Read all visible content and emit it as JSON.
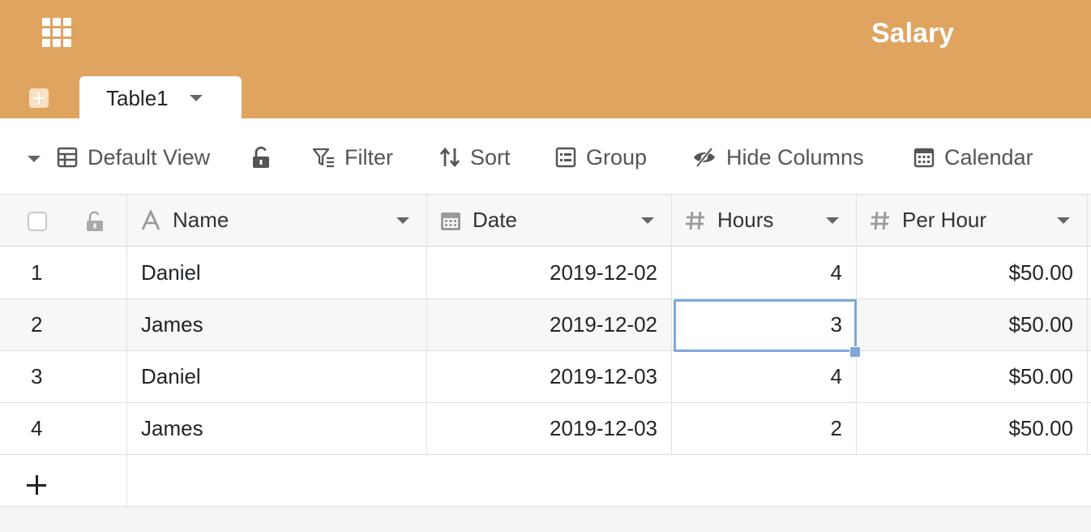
{
  "header": {
    "base_title": "Salary",
    "background_color": "#dea460",
    "apps_icon": "apps-grid-icon",
    "add_table_icon": "add-icon",
    "active_table": "Table1"
  },
  "toolbar": {
    "view_name": "Default View",
    "lock_icon": "lock-open-icon",
    "filter_label": "Filter",
    "sort_label": "Sort",
    "group_label": "Group",
    "hide_columns_label": "Hide Columns",
    "calendar_label": "Calendar"
  },
  "table": {
    "columns": [
      {
        "label": "Name",
        "type": "text",
        "icon": "text-type-icon"
      },
      {
        "label": "Date",
        "type": "date",
        "icon": "calendar-icon"
      },
      {
        "label": "Hours",
        "type": "number",
        "icon": "hash-icon"
      },
      {
        "label": "Per Hour",
        "type": "number",
        "icon": "hash-icon"
      }
    ],
    "rows": [
      {
        "index": "1",
        "name": "Daniel",
        "date": "2019-12-02",
        "hours": "4",
        "per_hour": "$50.00"
      },
      {
        "index": "2",
        "name": "James",
        "date": "2019-12-02",
        "hours": "3",
        "per_hour": "$50.00"
      },
      {
        "index": "3",
        "name": "Daniel",
        "date": "2019-12-03",
        "hours": "4",
        "per_hour": "$50.00"
      },
      {
        "index": "4",
        "name": "James",
        "date": "2019-12-03",
        "hours": "2",
        "per_hour": "$50.00"
      }
    ],
    "selected_cell": {
      "row": "2",
      "column": "Hours"
    },
    "selection_color": "#7fa8d8"
  }
}
